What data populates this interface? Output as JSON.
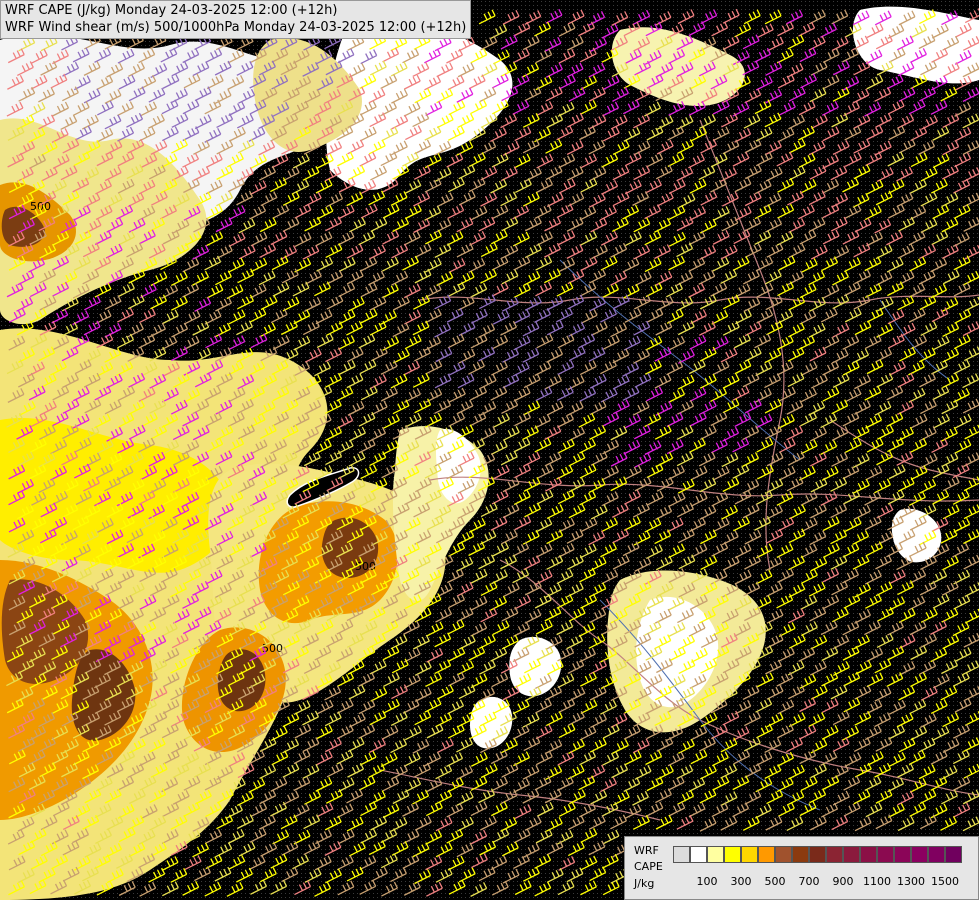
{
  "titles": {
    "line1": "WRF CAPE (J/kg) Monday 24-03-2025 12:00 (+12h)",
    "line2": "WRF Wind shear (m/s) 500/1000hPa Monday 24-03-2025 12:00 (+12h)"
  },
  "map_labels": [
    "500",
    "500",
    "500"
  ],
  "legend": {
    "labels": [
      "WRF",
      "CAPE",
      "J/kg"
    ],
    "ticks": [
      "100",
      "300",
      "500",
      "700",
      "900",
      "1100",
      "1300",
      "1500"
    ],
    "colors": [
      "#dcdcdc",
      "#ffffff",
      "#ffffa0",
      "#ffff00",
      "#ffd700",
      "#ff9900",
      "#a0522d",
      "#8b3a0f",
      "#7a2a1a",
      "#8b2433",
      "#8b1a3d",
      "#8b1046",
      "#8b0a50",
      "#8b0558",
      "#8b0060",
      "#800060",
      "#70005e"
    ]
  },
  "barb_colors": {
    "weak": "#c8a070",
    "moderate": "#e8e050",
    "strong": "#ffff00",
    "very_strong": "#f08080",
    "extreme": "#e020e0",
    "calm": "#9070c0"
  }
}
